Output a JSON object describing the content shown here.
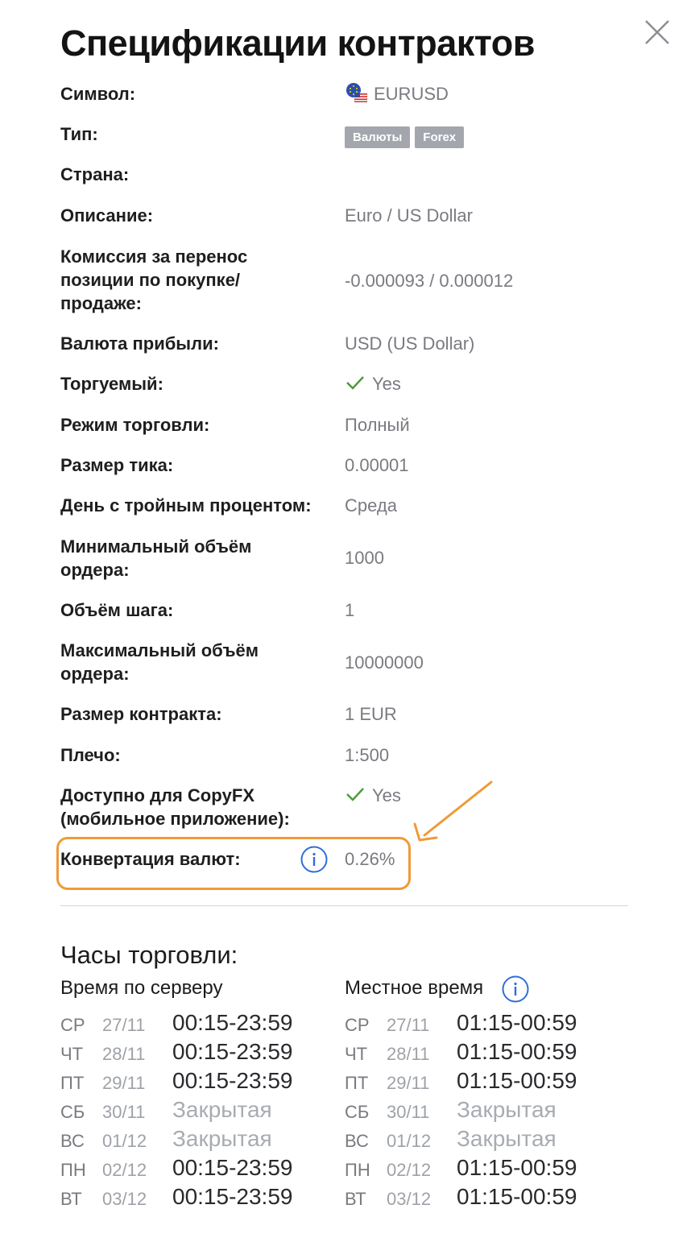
{
  "dialog": {
    "title": "Спецификации контрактов",
    "close_icon": "close-icon"
  },
  "specs": {
    "symbol": {
      "label": "Символ:",
      "value": "EURUSD",
      "icon": "eu-us-flag-icon"
    },
    "type": {
      "label": "Тип:",
      "badges": [
        "Валюты",
        "Forex"
      ]
    },
    "country": {
      "label": "Страна:",
      "value": ""
    },
    "description": {
      "label": "Описание:",
      "value": "Euro / US Dollar"
    },
    "swap": {
      "label": "Комиссия за перенос позиции по покупке/ продаже:",
      "label_lines": [
        "Комиссия за перенос",
        "позиции по покупке/",
        "продаже:"
      ],
      "value": "-0.000093 / 0.000012"
    },
    "profit_currency": {
      "label": "Валюта прибыли:",
      "value": "USD (US Dollar)"
    },
    "tradable": {
      "label": "Торгуемый:",
      "value": "Yes",
      "icon": "check-icon"
    },
    "trade_mode": {
      "label": "Режим торговли:",
      "value": "Полный"
    },
    "tick_size": {
      "label": "Размер тика:",
      "value": "0.00001"
    },
    "triple_day": {
      "label": "День с тройным процентом:",
      "value": "Среда"
    },
    "min_volume": {
      "label": "Минимальный объём ордера:",
      "label_lines": [
        "Минимальный объём",
        "ордера:"
      ],
      "value": "1000"
    },
    "step_volume": {
      "label": "Объём шага:",
      "value": "1"
    },
    "max_volume": {
      "label": "Максимальный объём ордера:",
      "label_lines": [
        "Максимальный объём",
        "ордера:"
      ],
      "value": "10000000"
    },
    "contract_size": {
      "label": "Размер контракта:",
      "value": "1 EUR"
    },
    "leverage": {
      "label": "Плечо:",
      "value": "1:500"
    },
    "copyfx": {
      "label": "Доступно для CopyFX (мобильное приложение):",
      "label_lines": [
        "Доступно для CopyFX",
        "(мобильное приложение):"
      ],
      "value": "Yes",
      "icon": "check-icon"
    },
    "conversion": {
      "label": "Конвертация валют:",
      "value": "0.26%",
      "icon": "info-icon"
    }
  },
  "colors": {
    "highlight": "#f09a38",
    "info": "#2f6fd6",
    "check": "#4c9a3a",
    "badge": "#a3a7ad"
  },
  "hours": {
    "title": "Часы торговли:",
    "server": {
      "heading": "Время по серверу",
      "rows": [
        {
          "day": "СР",
          "date": "27/11",
          "time": "00:15-23:59"
        },
        {
          "day": "ЧТ",
          "date": "28/11",
          "time": "00:15-23:59"
        },
        {
          "day": "ПТ",
          "date": "29/11",
          "time": "00:15-23:59"
        },
        {
          "day": "СБ",
          "date": "30/11",
          "time": "Закрытая"
        },
        {
          "day": "ВС",
          "date": "01/12",
          "time": "Закрытая"
        },
        {
          "day": "ПН",
          "date": "02/12",
          "time": "00:15-23:59"
        },
        {
          "day": "ВТ",
          "date": "03/12",
          "time": "00:15-23:59"
        }
      ]
    },
    "local": {
      "heading": "Местное время",
      "rows": [
        {
          "day": "СР",
          "date": "27/11",
          "time": "01:15-00:59"
        },
        {
          "day": "ЧТ",
          "date": "28/11",
          "time": "01:15-00:59"
        },
        {
          "day": "ПТ",
          "date": "29/11",
          "time": "01:15-00:59"
        },
        {
          "day": "СБ",
          "date": "30/11",
          "time": "Закрытая"
        },
        {
          "day": "ВС",
          "date": "01/12",
          "time": "Закрытая"
        },
        {
          "day": "ПН",
          "date": "02/12",
          "time": "01:15-00:59"
        },
        {
          "day": "ВТ",
          "date": "03/12",
          "time": "01:15-00:59"
        }
      ]
    }
  }
}
